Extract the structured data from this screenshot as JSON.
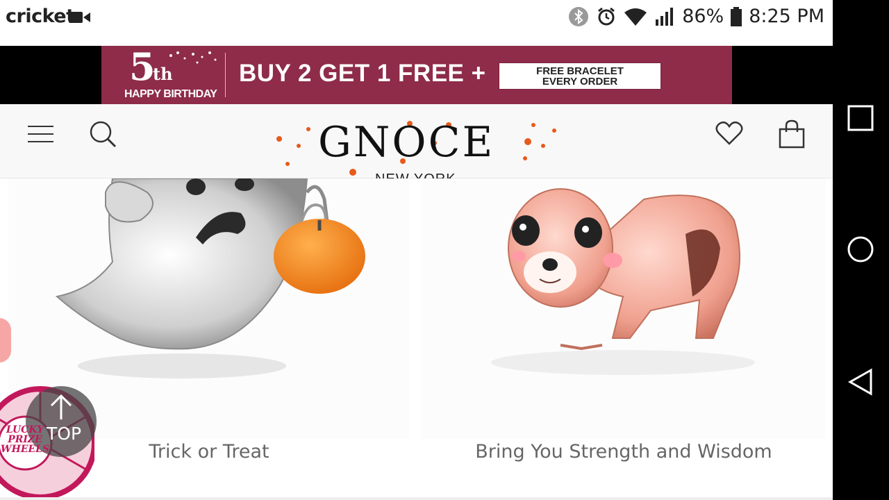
{
  "status_bar": {
    "carrier": "cricket",
    "battery": "86%",
    "time": "8:25 PM",
    "icons": [
      "video-camera-icon",
      "bluetooth-icon",
      "alarm-icon",
      "wifi-icon",
      "signal-icon",
      "battery-icon"
    ]
  },
  "banner": {
    "anniversary_number": "5",
    "anniversary_suffix": "th",
    "anniversary_text": "HAPPY BIRTHDAY",
    "offer": "BUY 2 GET 1 FREE +",
    "box_line1": "FREE BRACELET",
    "box_line2": "EVERY ORDER",
    "bg_color": "#8e2c49"
  },
  "header": {
    "logo": "GNOCE",
    "logo_sub": "NEW YORK"
  },
  "products": [
    {
      "title": "Trick or Treat"
    },
    {
      "title": "Bring You Strength and Wisdom"
    }
  ],
  "widgets": {
    "top_label": "TOP",
    "wheel_label": [
      "LUCKY",
      "PRIZE",
      "WHEELS"
    ]
  },
  "nav": {
    "icons": [
      "recent-apps-icon",
      "home-icon",
      "back-icon"
    ]
  }
}
